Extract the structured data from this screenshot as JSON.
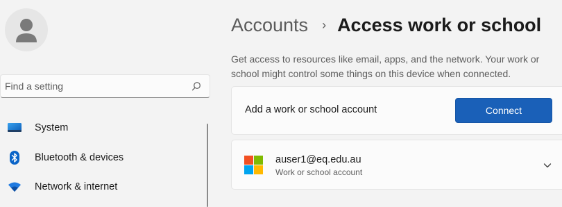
{
  "sidebar": {
    "search": {
      "placeholder": "Find a setting",
      "icon": "search-icon"
    },
    "items": [
      {
        "label": "System",
        "icon": "monitor-icon"
      },
      {
        "label": "Bluetooth & devices",
        "icon": "bluetooth-icon"
      },
      {
        "label": "Network & internet",
        "icon": "wifi-icon"
      }
    ]
  },
  "header": {
    "parent": "Accounts",
    "separator": "›",
    "current": "Access work or school"
  },
  "description": "Get access to resources like email, apps, and the network. Your work or school might control some things on this device when connected.",
  "add_account": {
    "label": "Add a work or school account",
    "button": "Connect"
  },
  "account": {
    "email": "auser1@eq.edu.au",
    "type": "Work or school account",
    "icon": "microsoft-logo-icon"
  },
  "colors": {
    "accent": "#1a60b8",
    "bluetooth": "#0a64c8",
    "logo_red": "#f25022",
    "logo_green": "#7fba00",
    "logo_blue": "#00a4ef",
    "logo_yellow": "#ffb900"
  }
}
